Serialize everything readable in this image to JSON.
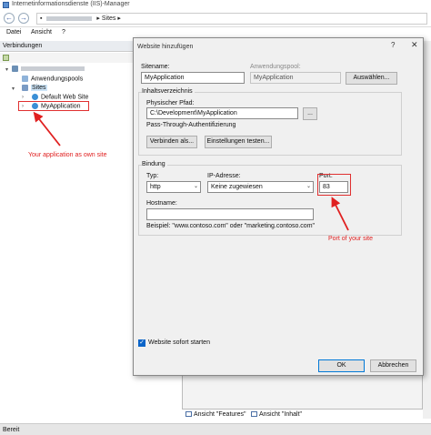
{
  "window": {
    "title": "Internetinformationsdienste (IIS)-Manager"
  },
  "addressbar": {
    "sites_crumb": "Sites"
  },
  "menu": {
    "file": "Datei",
    "view": "Ansicht",
    "help": "?"
  },
  "connections": {
    "header": "Verbindungen",
    "items": [
      {
        "label": "Anwendungspools"
      },
      {
        "label": "Sites"
      },
      {
        "label": "Default Web Site"
      },
      {
        "label": "MyApplication"
      }
    ]
  },
  "annotations": {
    "own_site": "Your application as own site",
    "port": "Port of your site"
  },
  "background_pane": {
    "features_tab": "Ansicht \"Features\"",
    "content_tab": "Ansicht \"Inhalt\""
  },
  "status": {
    "text": "Bereit"
  },
  "dialog": {
    "title": "Website hinzufügen",
    "help_glyph": "?",
    "close_glyph": "✕",
    "site_name_label": "Sitename:",
    "site_name_value": "MyApplication",
    "app_pool_label": "Anwendungspool:",
    "app_pool_value": "MyApplication",
    "select_button": "Auswählen...",
    "content_dir_group": "Inhaltsverzeichnis",
    "physical_path_label": "Physischer Pfad:",
    "physical_path_value": "C:\\Development\\MyApplication",
    "browse_button": "...",
    "passthrough_label": "Pass-Through-Authentifizierung",
    "connect_as_button": "Verbinden als...",
    "test_settings_button": "Einstellungen testen...",
    "binding_group": "Bindung",
    "type_label": "Typ:",
    "type_value": "http",
    "ip_label": "IP-Adresse:",
    "ip_value": "Keine zugewiesen",
    "port_label": "Port:",
    "port_value": "83",
    "hostname_label": "Hostname:",
    "hostname_value": "",
    "example_text": "Beispiel: \"www.contoso.com\" oder \"marketing.contoso.com\"",
    "start_now_label": "Website sofort starten",
    "ok_button": "OK",
    "cancel_button": "Abbrechen"
  },
  "colors": {
    "annotation": "#e02020",
    "accent": "#0078d7"
  }
}
